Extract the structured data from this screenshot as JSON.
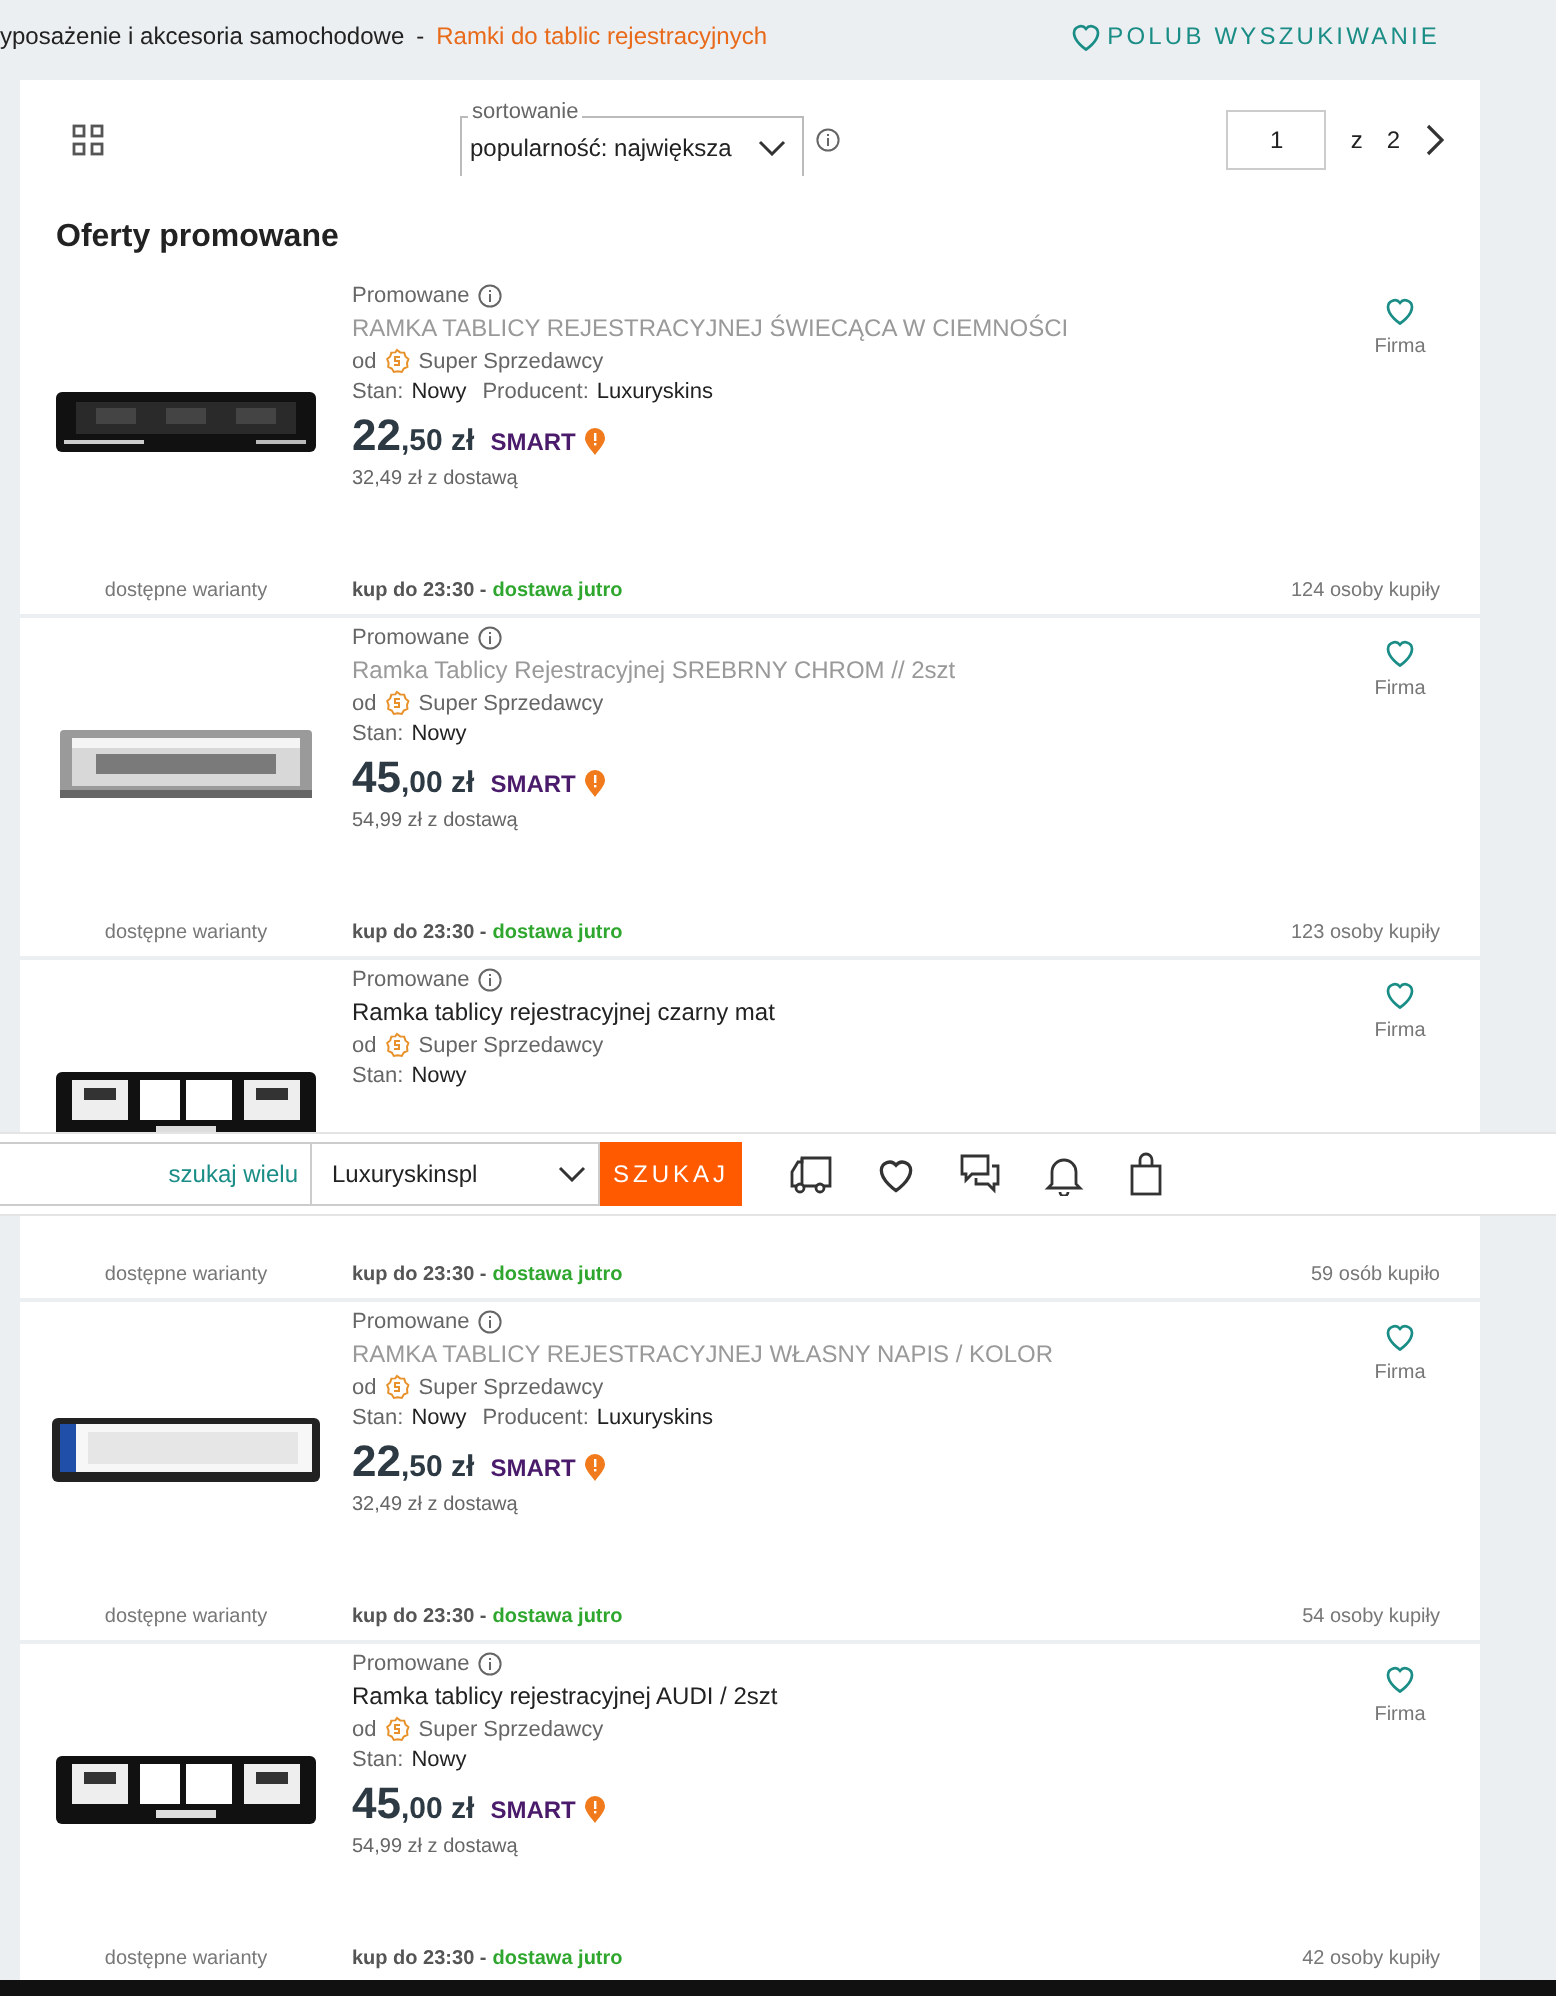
{
  "breadcrumb": {
    "parent": "yposażenie i akcesoria samochodowe",
    "separator": "-",
    "current": "Ramki do tablic rejestracyjnych"
  },
  "like_search": {
    "label": "POLUB WYSZUKIWANIE"
  },
  "toolbar": {
    "sort_legend": "sortowanie",
    "sort_value": "popularność: największa",
    "page_value": "1",
    "page_of": "z",
    "page_total": "2"
  },
  "section_title": "Oferty promowane",
  "offers": [
    {
      "badge": "Promowane",
      "title": "RAMKA TABLICY REJESTRACYJNEJ ŚWIECĄCA W CIEMNOŚCI",
      "visited": true,
      "seller_prefix": "od",
      "seller": "Super Sprzedawcy",
      "condition_label": "Stan:",
      "condition": "Nowy",
      "producer_label": "Producent:",
      "producer": "Luxuryskins",
      "price_main": "22",
      "price_fraction": ",50",
      "currency": "zł",
      "smart": "SMART",
      "delivery_price": "32,49 zł z dostawą",
      "favorite_label": "Firma",
      "variants": "dostępne warianty",
      "cutoff": "kup do 23:30 -",
      "delivery": "dostawa jutro",
      "buyers": "124 osoby kupiły"
    },
    {
      "badge": "Promowane",
      "title": "Ramka Tablicy Rejestracyjnej SREBRNY CHROM // 2szt",
      "visited": true,
      "seller_prefix": "od",
      "seller": "Super Sprzedawcy",
      "condition_label": "Stan:",
      "condition": "Nowy",
      "price_main": "45",
      "price_fraction": ",00",
      "currency": "zł",
      "smart": "SMART",
      "delivery_price": "54,99 zł z dostawą",
      "favorite_label": "Firma",
      "variants": "dostępne warianty",
      "cutoff": "kup do 23:30 -",
      "delivery": "dostawa jutro",
      "buyers": "123 osoby kupiły"
    },
    {
      "badge": "Promowane",
      "title": "Ramka tablicy rejestracyjnej czarny mat",
      "visited": false,
      "seller_prefix": "od",
      "seller": "Super Sprzedawcy",
      "condition_label": "Stan:",
      "condition": "Nowy",
      "favorite_label": "Firma",
      "variants": "dostępne warianty",
      "cutoff": "kup do 23:30 -",
      "delivery": "dostawa jutro",
      "buyers": "59 osób kupiło"
    },
    {
      "badge": "Promowane",
      "title": "RAMKA TABLICY REJESTRACYJNEJ WŁASNY NAPIS / KOLOR",
      "visited": true,
      "seller_prefix": "od",
      "seller": "Super Sprzedawcy",
      "condition_label": "Stan:",
      "condition": "Nowy",
      "producer_label": "Producent:",
      "producer": "Luxuryskins",
      "price_main": "22",
      "price_fraction": ",50",
      "currency": "zł",
      "smart": "SMART",
      "delivery_price": "32,49 zł z dostawą",
      "favorite_label": "Firma",
      "variants": "dostępne warianty",
      "cutoff": "kup do 23:30 -",
      "delivery": "dostawa jutro",
      "buyers": "54 osoby kupiły"
    },
    {
      "badge": "Promowane",
      "title": "Ramka tablicy rejestracyjnej AUDI / 2szt",
      "visited": false,
      "seller_prefix": "od",
      "seller": "Super Sprzedawcy",
      "condition_label": "Stan:",
      "condition": "Nowy",
      "price_main": "45",
      "price_fraction": ",00",
      "currency": "zł",
      "smart": "SMART",
      "delivery_price": "54,99 zł z dostawą",
      "favorite_label": "Firma",
      "variants": "dostępne warianty",
      "cutoff": "kup do 23:30 -",
      "delivery": "dostawa jutro",
      "buyers": "42 osoby kupiły"
    }
  ],
  "search_bar": {
    "multi_link": "szukaj wielu",
    "scope": "Luxuryskinspl",
    "button": "SZUKAJ"
  }
}
